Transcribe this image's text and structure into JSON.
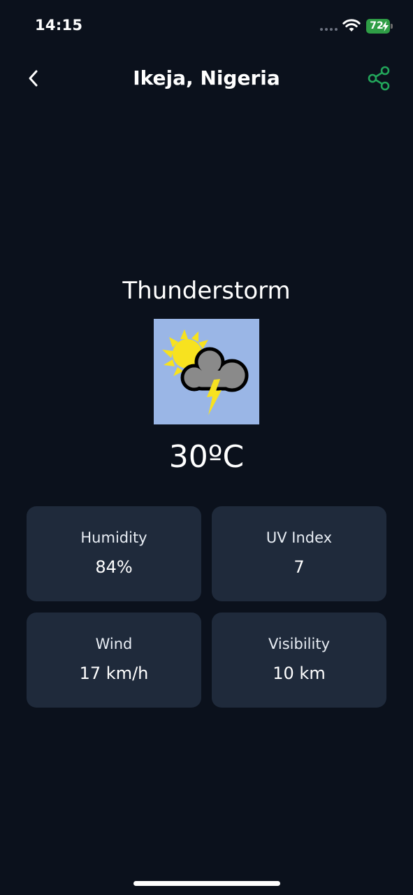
{
  "status_bar": {
    "time": "14:15",
    "battery_level": "72",
    "battery_color": "#2f9e46"
  },
  "header": {
    "title": "Ikeja, Nigeria",
    "back_icon": "chevron-left-icon",
    "share_icon": "share-icon",
    "accent_color": "#22a55a"
  },
  "weather": {
    "condition": "Thunderstorm",
    "icon": "thunderstorm-icon",
    "temperature": "30ºC"
  },
  "details": [
    {
      "label": "Humidity",
      "value": "84%"
    },
    {
      "label": "UV Index",
      "value": "7"
    },
    {
      "label": "Wind",
      "value": "17 km/h"
    },
    {
      "label": "Visibility",
      "value": "10 km"
    }
  ]
}
